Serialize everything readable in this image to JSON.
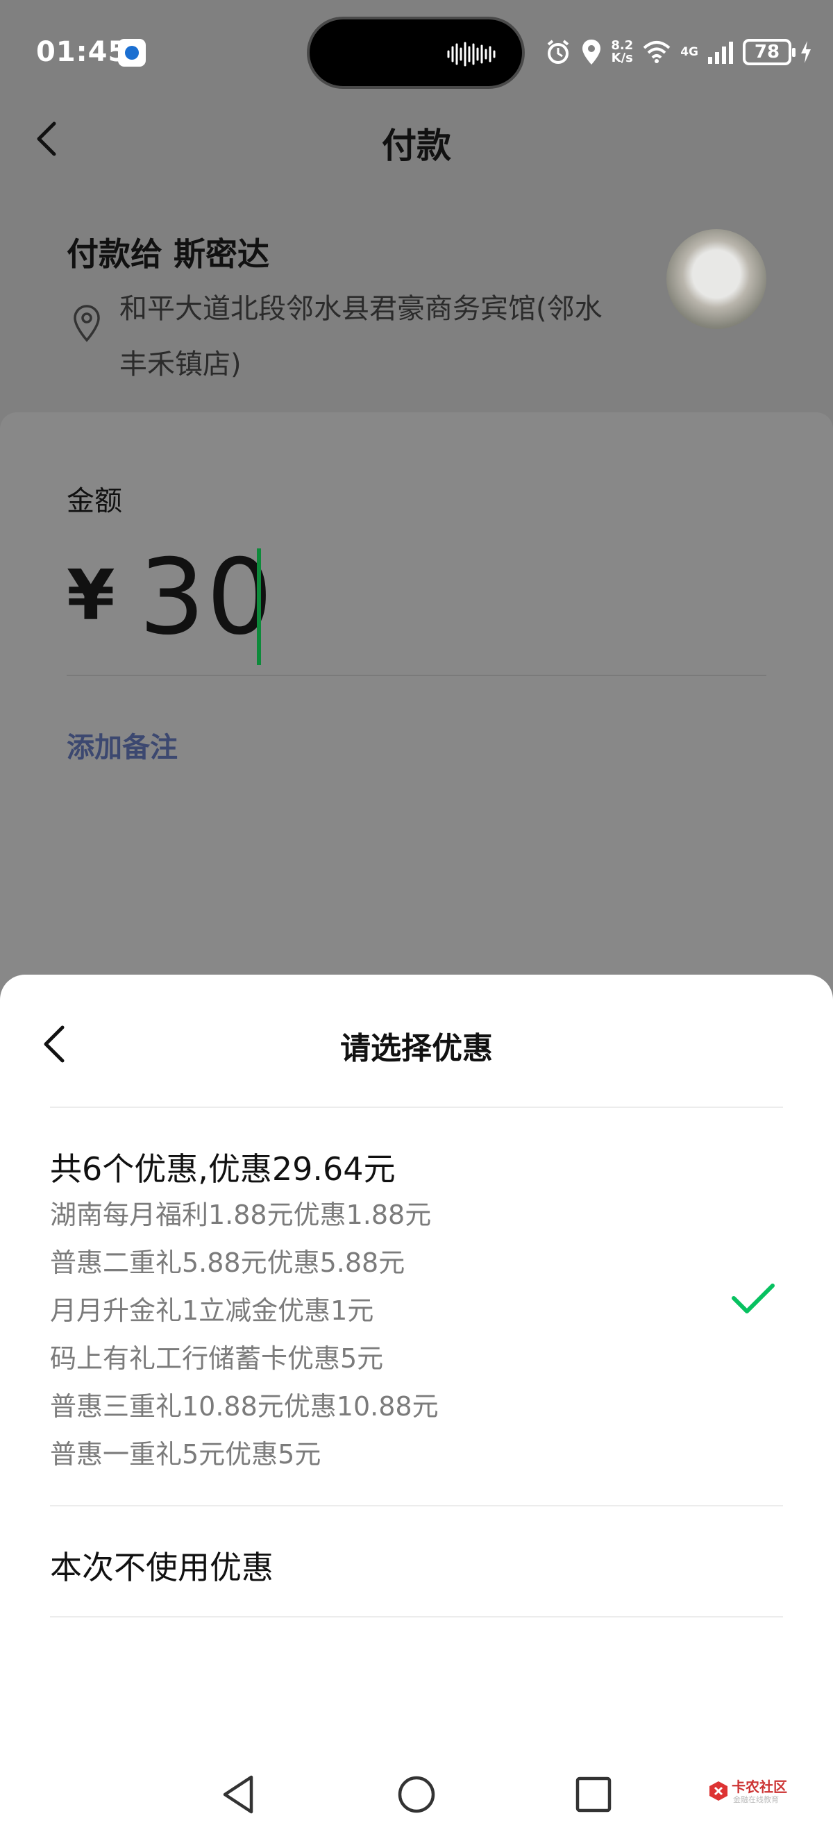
{
  "status_bar": {
    "time": "01:45",
    "net_speed_value": "8.2",
    "net_speed_unit": "K/s",
    "network_type": "4G",
    "battery": "78"
  },
  "header": {
    "title": "付款"
  },
  "payee": {
    "name": "付款给 斯密达",
    "address": "和平大道北段邻水县君豪商务宾馆(邻水丰禾镇店)"
  },
  "amount": {
    "label": "金额",
    "currency": "¥",
    "value": "30"
  },
  "note_link": "添加备注",
  "coupon_sheet": {
    "title": "请选择优惠",
    "summary": "共6个优惠,优惠29.64元",
    "coupons": [
      "湖南每月福利1.88元优惠1.88元",
      "普惠二重礼5.88元优惠5.88元",
      "月月升金礼1立减金优惠1元",
      "码上有礼工行储蓄卡优惠5元",
      "普惠三重礼10.88元优惠10.88元",
      "普惠一重礼5元优惠5元"
    ],
    "no_coupon_label": "本次不使用优惠",
    "selected": "summary"
  },
  "watermark": {
    "name": "卡农社区",
    "tagline": "金融在线教育"
  },
  "colors": {
    "accent": "#07c160",
    "overlay": "#808080",
    "link": "#3c4870"
  }
}
